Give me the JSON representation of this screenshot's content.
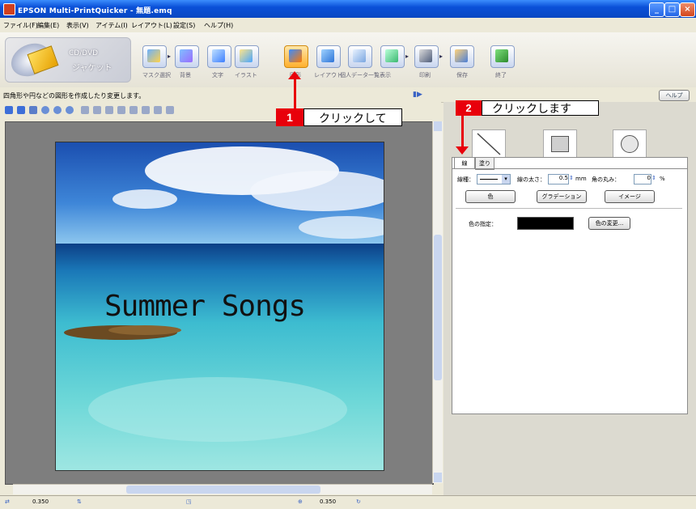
{
  "window": {
    "title": "EPSON Multi-PrintQuicker - 無題.emq"
  },
  "menu": [
    "ファイル(F)",
    "編集(E)",
    "表示(V)",
    "アイテム(I)",
    "レイアウト(L)",
    "設定(S)",
    "ヘルプ(H)"
  ],
  "logo": {
    "line1": "CD/DVD",
    "line2": "ジャケット"
  },
  "toolbar_labels": [
    "マスク選択",
    "背景",
    "文字",
    "イラスト",
    "図形",
    "レイアウト",
    "個人データ一覧表示",
    "印刷",
    "保存",
    "終了"
  ],
  "hint": "四角形や円などの図形を作成したり変更します。",
  "help_button": "ヘルプ",
  "page_text": "Summer Songs",
  "prop_tabs": [
    "線",
    "塗り"
  ],
  "props": {
    "line_type_label": "線種：",
    "line_width_label": "線の太さ：",
    "line_width_value": "0.5",
    "line_width_unit": "mm",
    "corner_label": "角の丸み：",
    "corner_value": "0",
    "corner_unit": "%",
    "btn_color": "色",
    "btn_gradation": "グラデーション",
    "btn_image": "イメージ",
    "color_spec_label": "色の指定：",
    "color_change_btn": "色の変更...",
    "color_value": "#000000"
  },
  "status": [
    "0.350",
    "0.350"
  ],
  "callout1": {
    "num": "1",
    "text": "クリックして"
  },
  "callout2": {
    "num": "2",
    "text": "クリックします"
  }
}
